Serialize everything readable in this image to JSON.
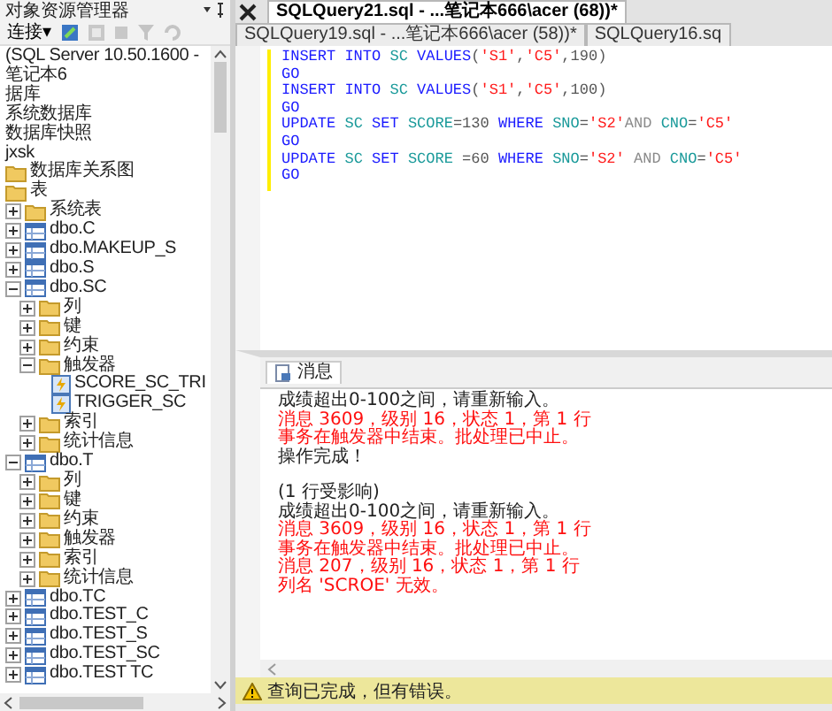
{
  "explorer": {
    "title": "对象资源管理器",
    "toolbar": {
      "connect": "连接▾"
    },
    "tree": [
      {
        "label": "(SQL Server 10.50.1600 - 笔记本6",
        "kind": "text"
      },
      {
        "label": "据库",
        "kind": "text"
      },
      {
        "label": "系统数据库",
        "kind": "text"
      },
      {
        "label": "数据库快照",
        "kind": "text"
      },
      {
        "label": "jxsk",
        "kind": "text"
      },
      {
        "label": "数据库关系图",
        "kind": "folder"
      },
      {
        "label": "表",
        "kind": "folder",
        "children": [
          {
            "label": "系统表",
            "kind": "folder",
            "expanded": false
          },
          {
            "label": "dbo.C",
            "kind": "table",
            "expanded": false
          },
          {
            "label": "dbo.MAKEUP_S",
            "kind": "table",
            "expanded": false
          },
          {
            "label": "dbo.S",
            "kind": "table",
            "expanded": false
          },
          {
            "label": "dbo.SC",
            "kind": "table",
            "expanded": true,
            "children": [
              {
                "label": "列",
                "kind": "folder",
                "expanded": false
              },
              {
                "label": "键",
                "kind": "folder",
                "expanded": false
              },
              {
                "label": "约束",
                "kind": "folder",
                "expanded": false
              },
              {
                "label": "触发器",
                "kind": "folder",
                "expanded": true,
                "children": [
                  {
                    "label": "SCORE_SC_TRI",
                    "kind": "trigger"
                  },
                  {
                    "label": "TRIGGER_SC",
                    "kind": "trigger"
                  }
                ]
              },
              {
                "label": "索引",
                "kind": "folder",
                "expanded": false
              },
              {
                "label": "统计信息",
                "kind": "folder",
                "expanded": false
              }
            ]
          },
          {
            "label": "dbo.T",
            "kind": "table",
            "expanded": true,
            "children": [
              {
                "label": "列",
                "kind": "folder",
                "expanded": false
              },
              {
                "label": "键",
                "kind": "folder",
                "expanded": false
              },
              {
                "label": "约束",
                "kind": "folder",
                "expanded": false
              },
              {
                "label": "触发器",
                "kind": "folder",
                "expanded": false
              },
              {
                "label": "索引",
                "kind": "folder",
                "expanded": false
              },
              {
                "label": "统计信息",
                "kind": "folder",
                "expanded": false
              }
            ]
          },
          {
            "label": "dbo.TC",
            "kind": "table",
            "expanded": false
          },
          {
            "label": "dbo.TEST_C",
            "kind": "table",
            "expanded": false
          },
          {
            "label": "dbo.TEST_S",
            "kind": "table",
            "expanded": false
          },
          {
            "label": "dbo.TEST_SC",
            "kind": "table",
            "expanded": false
          },
          {
            "label": "dbo.TEST TC",
            "kind": "table",
            "expanded": false
          }
        ]
      }
    ]
  },
  "tabs": [
    {
      "label": "SQLQuery21.sql - ...笔记本666\\acer (68))*",
      "selected": true
    },
    {
      "label": "SQLQuery19.sql - ...笔记本666\\acer (58))*",
      "selected": false
    },
    {
      "label": "SQLQuery16.sq",
      "selected": false
    }
  ],
  "editor": {
    "lines": [
      [
        {
          "t": "INSERT INTO ",
          "kind": "keyword"
        },
        {
          "t": "SC ",
          "kind": "name"
        },
        {
          "t": "VALUES",
          "kind": "keyword"
        },
        {
          "t": "(",
          "kind": "plain"
        },
        {
          "t": "'S1'",
          "kind": "string"
        },
        {
          "t": ",",
          "kind": "plain"
        },
        {
          "t": "'C5'",
          "kind": "string"
        },
        {
          "t": ",190)",
          "kind": "plain"
        }
      ],
      [
        {
          "t": "GO",
          "kind": "keyword"
        }
      ],
      [
        {
          "t": "INSERT INTO ",
          "kind": "keyword"
        },
        {
          "t": "SC ",
          "kind": "name"
        },
        {
          "t": "VALUES",
          "kind": "keyword"
        },
        {
          "t": "(",
          "kind": "plain"
        },
        {
          "t": "'S1'",
          "kind": "string"
        },
        {
          "t": ",",
          "kind": "plain"
        },
        {
          "t": "'C5'",
          "kind": "string"
        },
        {
          "t": ",100)",
          "kind": "plain"
        }
      ],
      [
        {
          "t": "GO",
          "kind": "keyword"
        }
      ],
      [
        {
          "t": "UPDATE ",
          "kind": "keyword"
        },
        {
          "t": "SC ",
          "kind": "name"
        },
        {
          "t": "SET ",
          "kind": "keyword"
        },
        {
          "t": "SCORE",
          "kind": "name"
        },
        {
          "t": "=130 ",
          "kind": "plain"
        },
        {
          "t": "WHERE ",
          "kind": "keyword"
        },
        {
          "t": "SNO",
          "kind": "name"
        },
        {
          "t": "=",
          "kind": "plain"
        },
        {
          "t": "'S2'",
          "kind": "string"
        },
        {
          "t": "AND ",
          "kind": "operator"
        },
        {
          "t": "CNO",
          "kind": "name"
        },
        {
          "t": "=",
          "kind": "plain"
        },
        {
          "t": "'C5'",
          "kind": "string"
        }
      ],
      [
        {
          "t": "GO",
          "kind": "keyword"
        }
      ],
      [
        {
          "t": "UPDATE ",
          "kind": "keyword"
        },
        {
          "t": "SC ",
          "kind": "name"
        },
        {
          "t": "SET ",
          "kind": "keyword"
        },
        {
          "t": "SCORE ",
          "kind": "name"
        },
        {
          "t": "=60 ",
          "kind": "plain"
        },
        {
          "t": "WHERE ",
          "kind": "keyword"
        },
        {
          "t": "SNO",
          "kind": "name"
        },
        {
          "t": "=",
          "kind": "plain"
        },
        {
          "t": "'S2' ",
          "kind": "string"
        },
        {
          "t": "AND ",
          "kind": "operator"
        },
        {
          "t": "CNO",
          "kind": "name"
        },
        {
          "t": "=",
          "kind": "plain"
        },
        {
          "t": "'C5'",
          "kind": "string"
        }
      ],
      [
        {
          "t": "GO",
          "kind": "keyword"
        }
      ]
    ]
  },
  "results": {
    "tab": "消息",
    "messages": [
      {
        "text": "成绩超出0-100之间，请重新输入。",
        "kind": "info"
      },
      {
        "text": "消息 3609，级别 16，状态 1，第 1 行",
        "kind": "error"
      },
      {
        "text": "事务在触发器中结束。批处理已中止。",
        "kind": "error"
      },
      {
        "text": "操作完成！",
        "kind": "info"
      },
      {
        "text": "(1 行受影响)",
        "kind": "count"
      },
      {
        "text": "成绩超出0-100之间，请重新输入。",
        "kind": "info"
      },
      {
        "text": "消息 3609，级别 16，状态 1，第 1 行",
        "kind": "error"
      },
      {
        "text": "事务在触发器中结束。批处理已中止。",
        "kind": "error"
      },
      {
        "text": "消息 207，级别 16，状态 1，第 1 行",
        "kind": "error"
      },
      {
        "text": "列名 'SCROE' 无效。",
        "kind": "error"
      }
    ]
  },
  "status_bar": {
    "text": "查询已完成，但有错误。"
  }
}
